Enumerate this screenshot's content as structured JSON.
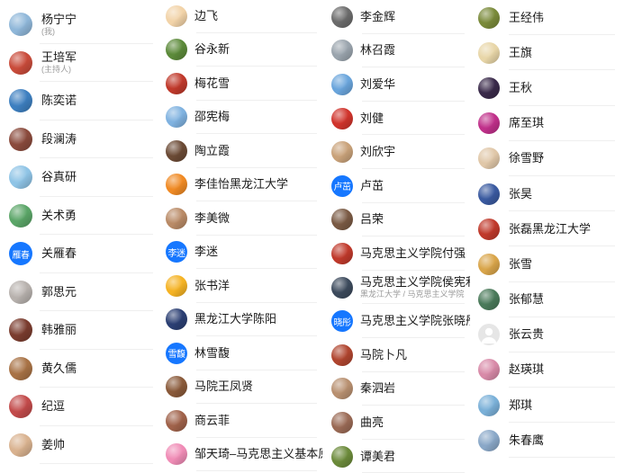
{
  "columns": [
    {
      "items": [
        {
          "name": "杨宁宁",
          "sub": "(我)",
          "icon": "photo-avatar",
          "color": "#8fb7d9"
        },
        {
          "name": "王培军",
          "sub": "(主持人)",
          "icon": "photo-avatar",
          "color": "#c94b3a"
        },
        {
          "name": "陈奕诺",
          "icon": "photo-avatar",
          "color": "#3d7fc0"
        },
        {
          "name": "段澜涛",
          "icon": "photo-avatar",
          "color": "#8a4a3c"
        },
        {
          "name": "谷真研",
          "icon": "photo-avatar",
          "color": "#8fc4e6"
        },
        {
          "name": "关术勇",
          "icon": "photo-avatar",
          "color": "#5aa567"
        },
        {
          "name": "关雁春",
          "icon": "text-avatar",
          "avatar_text": "雁春",
          "color": "#1677ff"
        },
        {
          "name": "郭思元",
          "icon": "photo-avatar",
          "color": "#b7b1ad"
        },
        {
          "name": "韩雅丽",
          "icon": "photo-avatar",
          "color": "#7a3c2e"
        },
        {
          "name": "黄久儒",
          "icon": "photo-avatar",
          "color": "#a87245"
        },
        {
          "name": "纪逗",
          "icon": "photo-avatar",
          "color": "#c24a4a"
        },
        {
          "name": "姜帅",
          "icon": "photo-avatar",
          "color": "#d9b28f"
        }
      ]
    },
    {
      "items": [
        {
          "name": "边飞",
          "icon": "photo-avatar",
          "color": "#f2d3a8"
        },
        {
          "name": "谷永新",
          "icon": "photo-avatar",
          "color": "#5c8a3a"
        },
        {
          "name": "梅花雪",
          "icon": "photo-avatar",
          "color": "#c0392b"
        },
        {
          "name": "邵宪梅",
          "icon": "photo-avatar",
          "color": "#7fb2e0"
        },
        {
          "name": "陶立霞",
          "icon": "photo-avatar",
          "color": "#6b4a35"
        },
        {
          "name": "李佳怡黑龙江大学",
          "icon": "photo-avatar",
          "color": "#f08a24"
        },
        {
          "name": "李美微",
          "icon": "photo-avatar",
          "color": "#b98a66"
        },
        {
          "name": "李迷",
          "icon": "text-avatar",
          "avatar_text": "李迷",
          "color": "#1677ff"
        },
        {
          "name": "张书洋",
          "icon": "photo-avatar",
          "color": "#f5b324"
        },
        {
          "name": "黑龙江大学陈阳",
          "icon": "photo-avatar",
          "color": "#2b3f73"
        },
        {
          "name": "林雪馥",
          "icon": "text-avatar",
          "avatar_text": "雪馥",
          "color": "#1677ff"
        },
        {
          "name": "马院王凤贤",
          "icon": "photo-avatar",
          "color": "#8a5a3a"
        },
        {
          "name": "商云菲",
          "icon": "photo-avatar",
          "color": "#a0624a"
        },
        {
          "name": "邹天琦–马克思主义基本原理",
          "icon": "photo-avatar",
          "color": "#f08cb6"
        }
      ]
    },
    {
      "items": [
        {
          "name": "李金辉",
          "icon": "photo-avatar",
          "color": "#6b6b6b"
        },
        {
          "name": "林召霞",
          "icon": "photo-avatar",
          "color": "#9aa4ad"
        },
        {
          "name": "刘爱华",
          "icon": "photo-avatar",
          "color": "#6aa5dc"
        },
        {
          "name": "刘健",
          "icon": "photo-avatar",
          "color": "#d0342c"
        },
        {
          "name": "刘欣宇",
          "icon": "photo-avatar",
          "color": "#c9a27a"
        },
        {
          "name": "卢茁",
          "icon": "text-avatar",
          "avatar_text": "卢茁",
          "color": "#1677ff"
        },
        {
          "name": "吕荣",
          "icon": "photo-avatar",
          "color": "#7a5a44"
        },
        {
          "name": "马克思主义学院付强",
          "icon": "photo-avatar",
          "color": "#c0392b"
        },
        {
          "name": "马克思主义学院侯宪利",
          "sub": "黑龙江大学 / 马克思主义学院",
          "icon": "photo-avatar",
          "color": "#3c4a5c"
        },
        {
          "name": "马克思主义学院张晓彤",
          "icon": "text-avatar",
          "avatar_text": "晓彤",
          "color": "#1677ff"
        },
        {
          "name": "马院卜凡",
          "icon": "photo-avatar",
          "color": "#b0452f"
        },
        {
          "name": "秦泗岩",
          "icon": "photo-avatar",
          "color": "#b89070"
        },
        {
          "name": "曲亮",
          "icon": "photo-avatar",
          "color": "#9a6a55"
        },
        {
          "name": "谭美君",
          "icon": "photo-avatar",
          "color": "#6b8a3a"
        }
      ]
    },
    {
      "items": [
        {
          "name": "王经伟",
          "icon": "photo-avatar",
          "color": "#7a8a3a"
        },
        {
          "name": "王旗",
          "icon": "photo-avatar",
          "color": "#e8d6a8"
        },
        {
          "name": "王秋",
          "icon": "photo-avatar",
          "color": "#3a2a4a"
        },
        {
          "name": "席至琪",
          "icon": "photo-avatar",
          "color": "#c0308a"
        },
        {
          "name": "徐雪野",
          "icon": "photo-avatar",
          "color": "#e0c7a8"
        },
        {
          "name": "张昊",
          "icon": "photo-avatar",
          "color": "#3a5aa0"
        },
        {
          "name": "张磊黑龙江大学",
          "icon": "photo-avatar",
          "color": "#c0392b"
        },
        {
          "name": "张雪",
          "icon": "photo-avatar",
          "color": "#d9a54a"
        },
        {
          "name": "张郁慧",
          "icon": "photo-avatar",
          "color": "#4a7a5a"
        },
        {
          "name": "张云贵",
          "icon": "default-avatar",
          "color": "#d6d6d6"
        },
        {
          "name": "赵瑛琪",
          "icon": "photo-avatar",
          "color": "#d88aa8"
        },
        {
          "name": "郑琪",
          "icon": "photo-avatar",
          "color": "#7ab0d8"
        },
        {
          "name": "朱春鹰",
          "icon": "photo-avatar",
          "color": "#8aa8c8"
        }
      ]
    }
  ]
}
